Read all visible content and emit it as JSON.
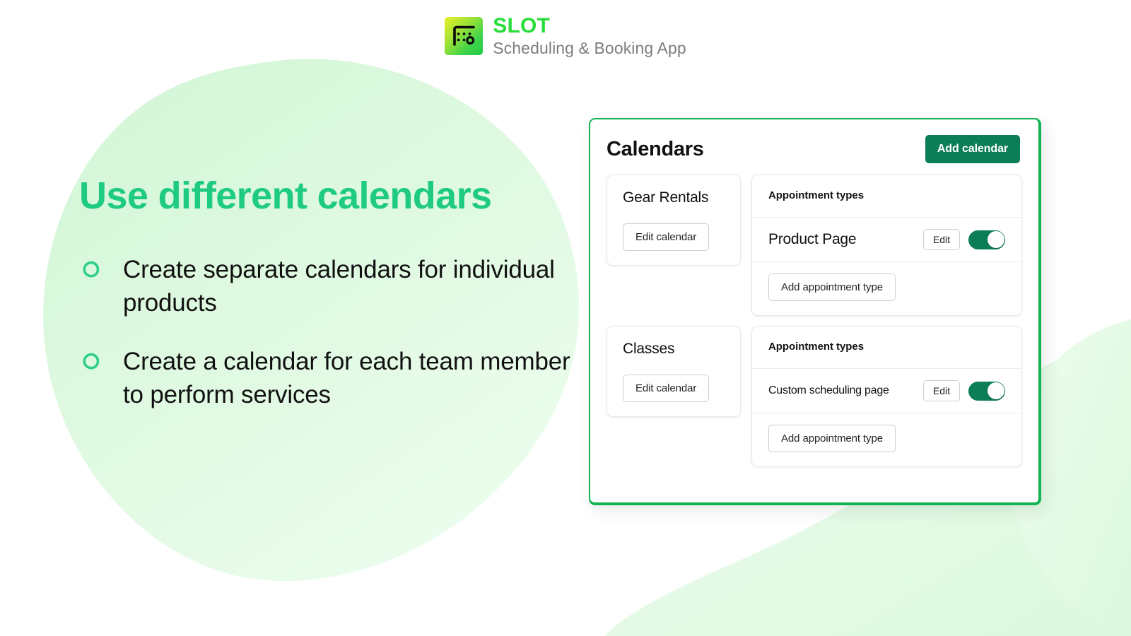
{
  "brand": {
    "logo_icon": "calendar-slot-icon",
    "title": "SLOT",
    "subtitle": "Scheduling & Booking App",
    "title_color": "#26dd39",
    "subtitle_color": "#7d7d7d"
  },
  "hero": {
    "headline": "Use different calendars",
    "headline_color": "#1ecb80",
    "bullet_icon": "swirl-icon",
    "bullets": [
      {
        "text": "Create separate calendars for individual products"
      },
      {
        "text": "Create a calendar for each team member to perform services"
      }
    ]
  },
  "panel": {
    "title": "Calendars",
    "add_calendar_label": "Add calendar",
    "border_color": "#12b352",
    "primary_color": "#0c7e57",
    "calendars": [
      {
        "name": "Gear Rentals",
        "edit_label": "Edit calendar",
        "types_header": "Appointment types",
        "add_type_label": "Add appointment type",
        "types": [
          {
            "name": "Product Page",
            "edit_label": "Edit",
            "enabled": true,
            "size": "large"
          }
        ]
      },
      {
        "name": "Classes",
        "edit_label": "Edit calendar",
        "types_header": "Appointment types",
        "add_type_label": "Add appointment type",
        "types": [
          {
            "name": "Custom scheduling page",
            "edit_label": "Edit",
            "enabled": true,
            "size": "small"
          }
        ]
      }
    ]
  },
  "decor": {
    "blob_primary_color": "#d8f7d9",
    "blob_secondary_color": "#e6fbe8"
  }
}
